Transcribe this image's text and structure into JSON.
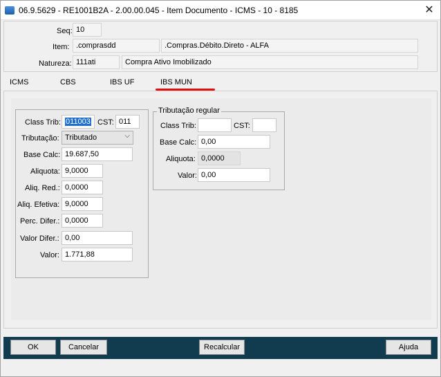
{
  "window": {
    "title": "06.9.5629 - RE1001B2A - 2.00.00.045 - Item Documento - ICMS - 10 - 8185"
  },
  "header": {
    "seq_label": "Seq:",
    "seq_value": "10",
    "item_label": "Item:",
    "item_code": ".comprasdd",
    "item_desc": ".Compras.Débito.Direto - ALFA",
    "natureza_label": "Natureza:",
    "natureza_code": "111ati",
    "natureza_desc": "Compra Ativo Imobilizado"
  },
  "tabs": [
    {
      "label": "ICMS"
    },
    {
      "label": "CBS"
    },
    {
      "label": "IBS UF"
    },
    {
      "label": "IBS MUN",
      "active": true
    }
  ],
  "left_group": {
    "class_trib_label": "Class Trib:",
    "class_trib_value": "011003",
    "cst_label": "CST:",
    "cst_value": "011",
    "tributacao_label": "Tributação:",
    "tributacao_value": "Tributado",
    "base_calc_label": "Base Calc:",
    "base_calc_value": "19.687,50",
    "aliquota_label": "Aliquota:",
    "aliquota_value": "9,0000",
    "aliq_red_label": "Aliq. Red.:",
    "aliq_red_value": "0,0000",
    "aliq_efetiva_label": "Aliq. Efetiva:",
    "aliq_efetiva_value": "9,0000",
    "perc_difer_label": "Perc. Difer.:",
    "perc_difer_value": "0,0000",
    "valor_difer_label": "Valor Difer.:",
    "valor_difer_value": "0,00",
    "valor_label": "Valor:",
    "valor_value": "1.771,88"
  },
  "right_group": {
    "legend": "Tributação regular",
    "class_trib_label": "Class Trib:",
    "class_trib_value": "",
    "cst_label": "CST:",
    "cst_value": "",
    "base_calc_label": "Base Calc:",
    "base_calc_value": "0,00",
    "aliquota_label": "Aliquota:",
    "aliquota_value": "0,0000",
    "valor_label": "Valor:",
    "valor_value": "0,00"
  },
  "buttons": {
    "ok": "OK",
    "cancel": "Cancelar",
    "recalc": "Recalcular",
    "help": "Ajuda"
  },
  "colors": {
    "bottom_bar": "#113b4f",
    "tab_indicator": "#e01010",
    "selection": "#1e6fd1"
  }
}
